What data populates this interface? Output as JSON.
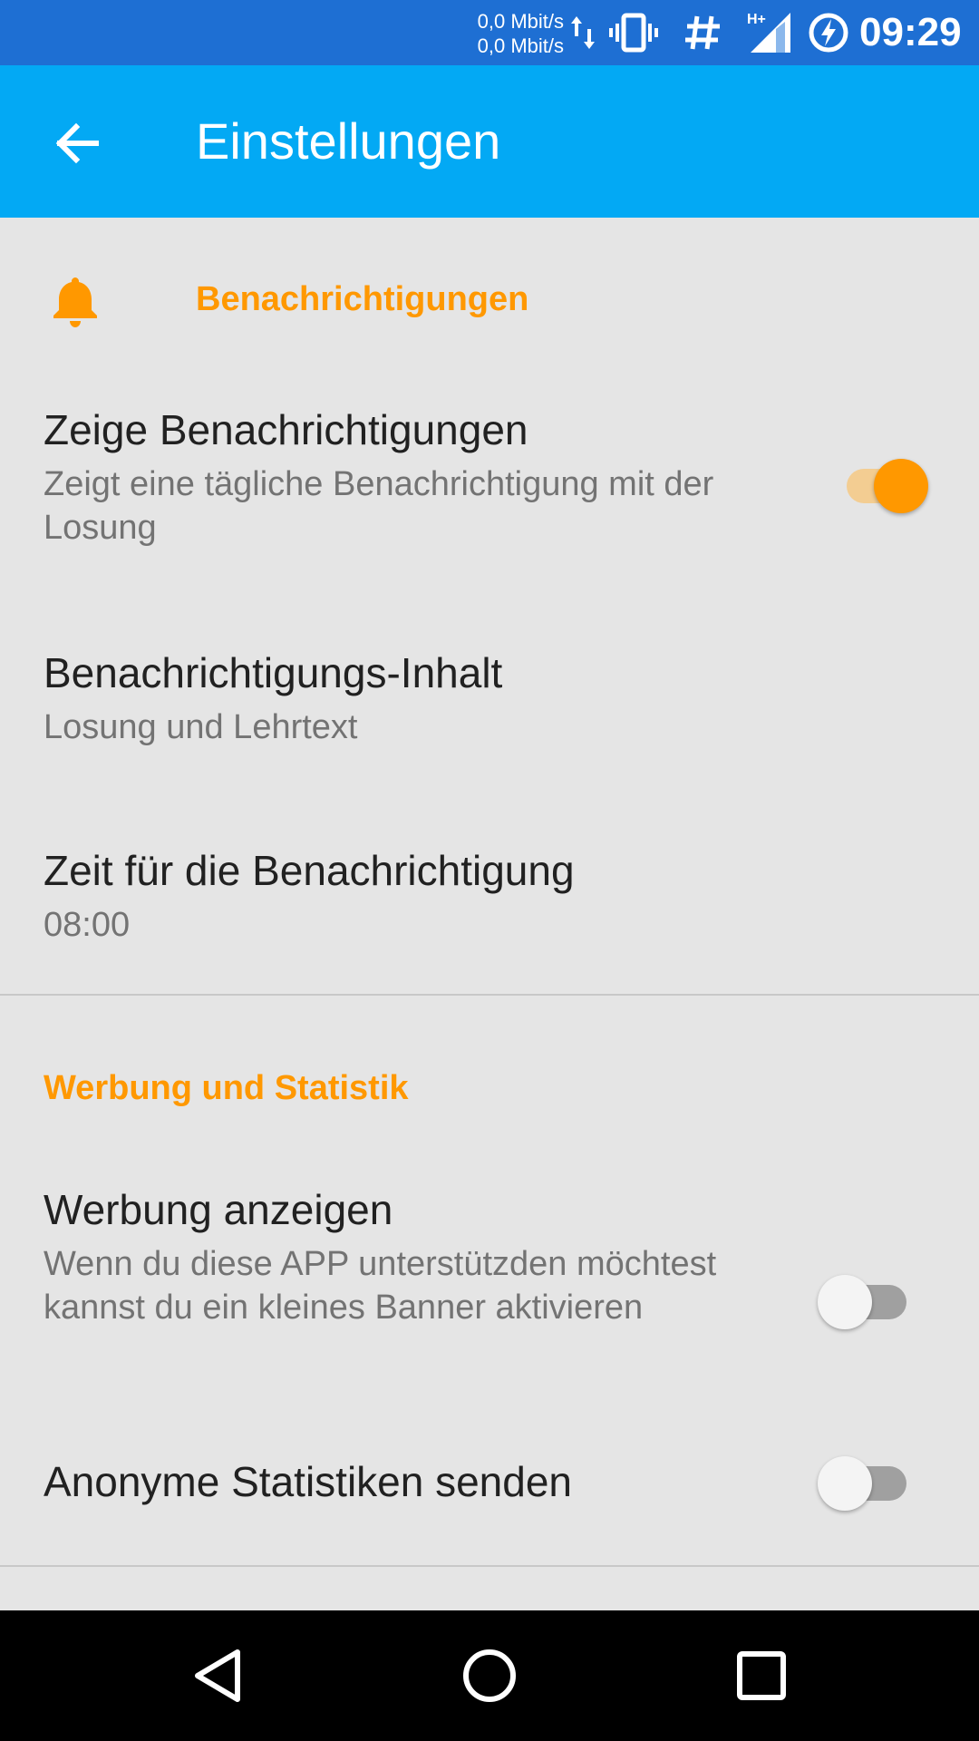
{
  "status_bar": {
    "net_up": "0,0 Mbit/s",
    "net_down": "0,0 Mbit/s",
    "network_type": "H+",
    "time": "09:29",
    "icons": [
      "data-transfer-icon",
      "vibrate-icon",
      "hash-icon",
      "signal-icon",
      "battery-charging-icon"
    ]
  },
  "app_bar": {
    "title": "Einstellungen",
    "back_icon": "arrow-back-icon"
  },
  "sections": {
    "notifications": {
      "header": "Benachrichtigungen",
      "icon": "bell-icon",
      "show": {
        "title": "Zeige Benachrichtigungen",
        "summary": "Zeigt eine tägliche Benachrichtigung mit der Losung",
        "enabled": true
      },
      "content": {
        "title": "Benachrichtigungs-Inhalt",
        "summary": "Losung und Lehrtext"
      },
      "time": {
        "title": "Zeit für die Benachrichtigung",
        "summary": "08:00"
      }
    },
    "ads": {
      "header": "Werbung und Statistik",
      "show_ads": {
        "title": "Werbung anzeigen",
        "summary": "Wenn du diese APP unterstützden möchtest kannst du ein kleines Banner aktivieren",
        "enabled": false
      },
      "stats": {
        "title": "Anonyme Statistiken senden",
        "enabled": false
      }
    }
  },
  "nav_bar": {
    "back_icon": "nav-back-icon",
    "home_icon": "nav-home-icon",
    "recents_icon": "nav-recents-icon"
  },
  "colors": {
    "status_bar": "#1e6fd3",
    "app_bar": "#03a9f4",
    "accent": "#ff9800",
    "background": "#e5e5e5"
  }
}
